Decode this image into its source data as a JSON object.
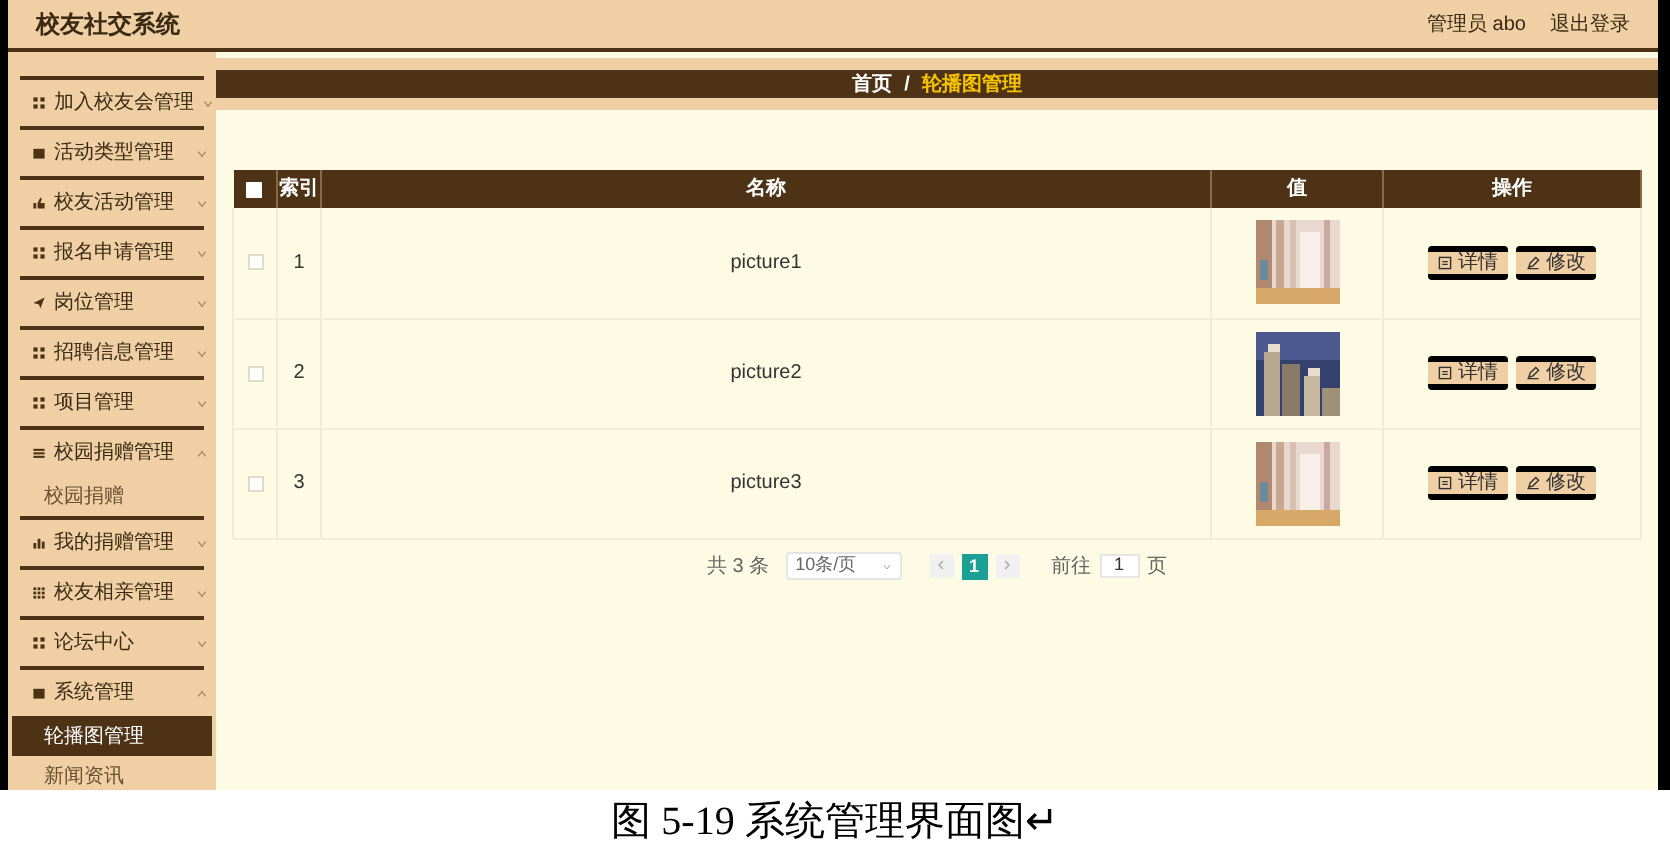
{
  "header": {
    "title": "校友社交系统",
    "user": "管理员 abo",
    "logout": "退出登录"
  },
  "sidebar": {
    "items": [
      {
        "label": "加入校友会管理",
        "expanded": false
      },
      {
        "label": "活动类型管理",
        "expanded": false
      },
      {
        "label": "校友活动管理",
        "expanded": false
      },
      {
        "label": "报名申请管理",
        "expanded": false
      },
      {
        "label": "岗位管理",
        "expanded": false
      },
      {
        "label": "招聘信息管理",
        "expanded": false
      },
      {
        "label": "项目管理",
        "expanded": false
      },
      {
        "label": "校园捐赠管理",
        "expanded": true,
        "children": [
          {
            "label": "校园捐赠",
            "selected": false
          }
        ]
      },
      {
        "label": "我的捐赠管理",
        "expanded": false
      },
      {
        "label": "校友相亲管理",
        "expanded": false
      },
      {
        "label": "论坛中心",
        "expanded": false
      },
      {
        "label": "系统管理",
        "expanded": true,
        "children": [
          {
            "label": "轮播图管理",
            "selected": true
          },
          {
            "label": "新闻资讯",
            "selected": false
          }
        ]
      }
    ]
  },
  "breadcrumb": [
    "首页",
    "/",
    "轮播图管理"
  ],
  "table": {
    "all_checked": false,
    "columns": [
      "索引",
      "名称",
      "值",
      "操作"
    ],
    "rows": [
      {
        "checked": false,
        "index": "1",
        "name": "picture1",
        "value": {
          "kind": "picture"
        },
        "actions": [
          "详情",
          "修改"
        ]
      },
      {
        "checked": false,
        "index": "2",
        "name": "picture2",
        "value": {
          "kind": "picture"
        },
        "actions": [
          "详情",
          "修改"
        ]
      },
      {
        "checked": false,
        "index": "3",
        "name": "picture3",
        "value": {
          "kind": "picture"
        },
        "actions": [
          "详情",
          "修改"
        ]
      }
    ]
  },
  "pagination": {
    "total": "共 3 条",
    "page_size": "10条/页",
    "pages": [
      {
        "label": "1",
        "selected": true
      }
    ],
    "goto_label": "前往",
    "goto_value": "1",
    "page_unit": "页"
  },
  "caption": "图 5-19 系统管理界面图↵"
}
